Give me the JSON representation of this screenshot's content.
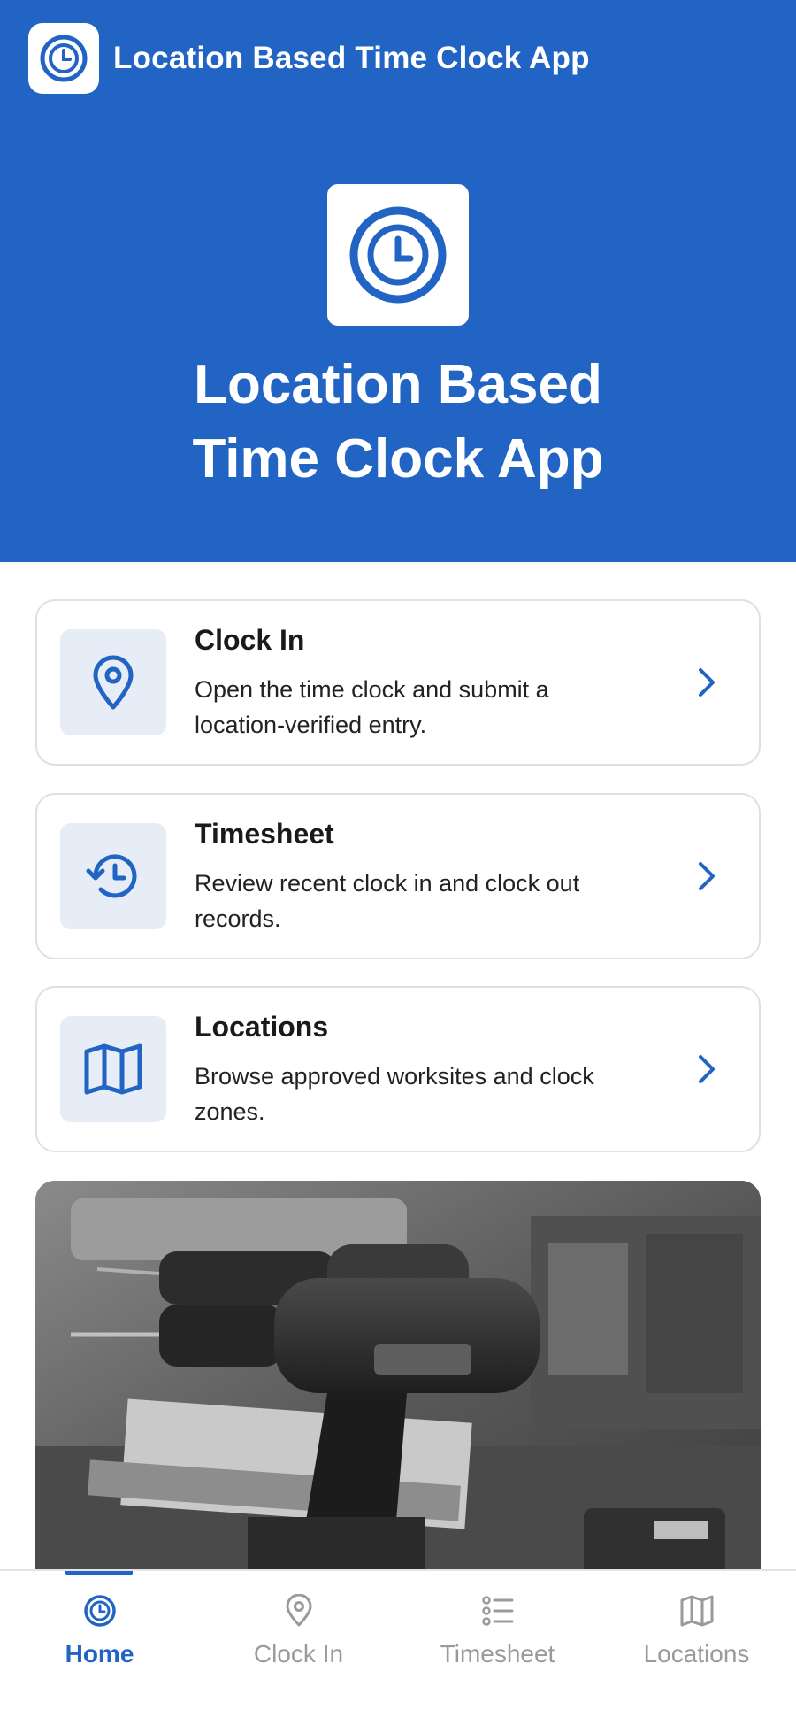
{
  "app": {
    "title": "Location Based Time Clock App"
  },
  "hero": {
    "title_line1": "Location Based",
    "title_line2": "Time Clock App"
  },
  "cards": [
    {
      "title": "Clock In",
      "description": "Open the time clock and submit a location-verified entry.",
      "icon": "location-pin-icon"
    },
    {
      "title": "Timesheet",
      "description": "Review recent clock in and clock out records.",
      "icon": "history-icon"
    },
    {
      "title": "Locations",
      "description": "Browse approved worksites and clock zones.",
      "icon": "map-icon"
    }
  ],
  "photo": {
    "description_icon": "drill-photo"
  },
  "bottom_nav": [
    {
      "label": "Home",
      "icon": "clock-icon",
      "active": true
    },
    {
      "label": "Clock In",
      "icon": "location-pin-icon",
      "active": false
    },
    {
      "label": "Timesheet",
      "icon": "list-icon",
      "active": false
    },
    {
      "label": "Locations",
      "icon": "map-icon",
      "active": false
    }
  ],
  "colors": {
    "primary": "#2264c4",
    "card_border": "#dde0e8",
    "icon_tile": "#e7edf7",
    "inactive": "#9a9a9a"
  }
}
